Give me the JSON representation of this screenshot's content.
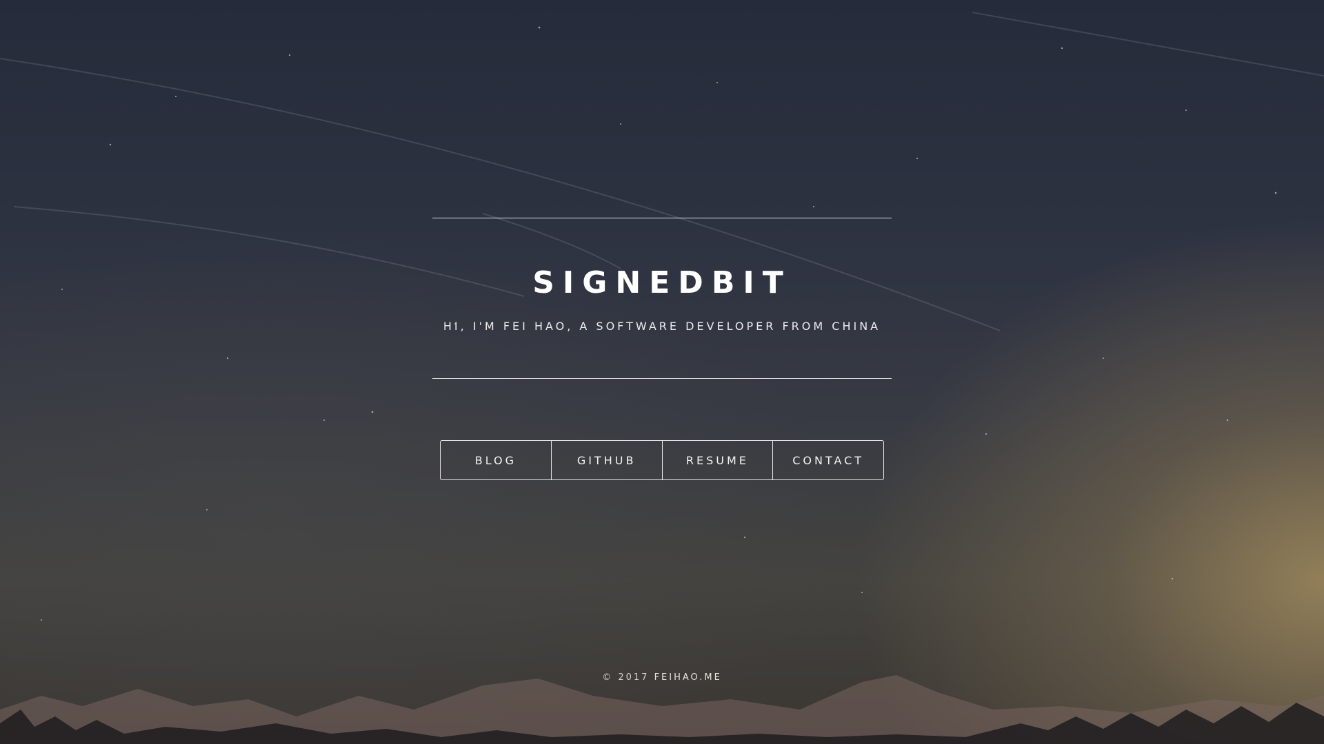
{
  "hero": {
    "title": "SIGNEDBIT",
    "subtitle": "HI, I'M FEI HAO, A SOFTWARE DEVELOPER FROM CHINA"
  },
  "nav": {
    "items": [
      {
        "label": "BLOG"
      },
      {
        "label": "GITHUB"
      },
      {
        "label": "RESUME"
      },
      {
        "label": "CONTACT"
      }
    ]
  },
  "footer": {
    "copyright": "© 2017",
    "site": "FEIHAO.ME"
  },
  "colors": {
    "text": "#ffffff",
    "sky_top": "#262b3b",
    "horizon_glow": "#968259"
  }
}
